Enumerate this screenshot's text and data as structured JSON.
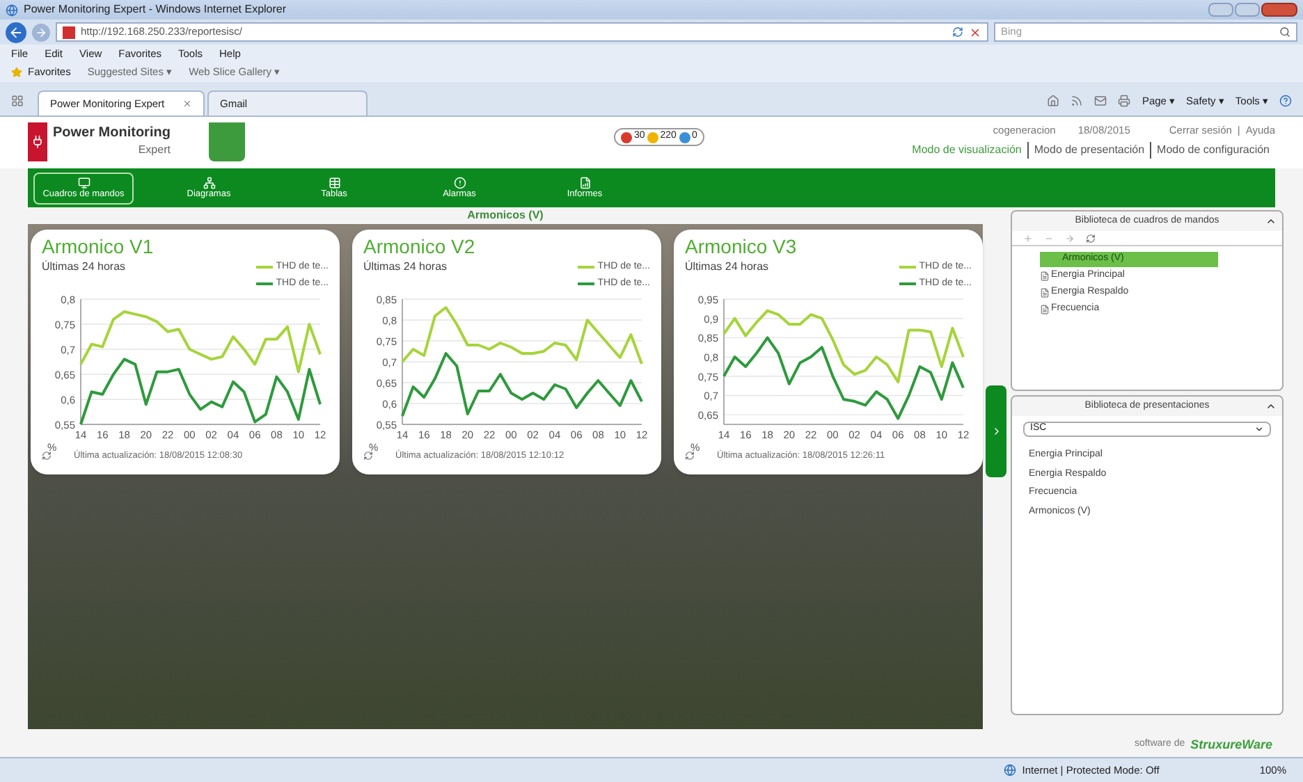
{
  "browser": {
    "title": "Power Monitoring Expert - Windows Internet Explorer",
    "address": "http://192.168.250.233/reportesisc/",
    "search_placeholder": "Bing",
    "menu": [
      "File",
      "Edit",
      "View",
      "Favorites",
      "Tools",
      "Help"
    ],
    "favorites_label": "Favorites",
    "favorites_links": [
      "Suggested Sites ▾",
      "Web Slice Gallery ▾"
    ],
    "tabs": [
      {
        "label": "Power Monitoring Expert",
        "selected": true
      },
      {
        "label": "Gmail",
        "selected": false
      }
    ],
    "commands": [
      "Page ▾",
      "Safety ▾",
      "Tools ▾"
    ],
    "status": "Internet | Protected Mode: Off",
    "zoom": "100%"
  },
  "app": {
    "logo": {
      "line1": "Power Monitoring",
      "line2": "Expert"
    },
    "alarms": [
      {
        "kind": "critical",
        "count": "30"
      },
      {
        "kind": "warning",
        "count": "220"
      },
      {
        "kind": "info",
        "count": "0"
      }
    ],
    "user": "cogeneracion",
    "date": "18/08/2015",
    "links": [
      "Cerrar sesión",
      "Ayuda"
    ],
    "link_separator": "|",
    "modes": [
      {
        "label": "Modo de visualización",
        "selected": true
      },
      {
        "label": "Modo de presentación",
        "selected": false
      },
      {
        "label": "Modo de configuración",
        "selected": false
      }
    ],
    "nav": [
      {
        "kind": "dashboards",
        "label": "Cuadros de mandos",
        "selected": true
      },
      {
        "kind": "diagrams",
        "label": "Diagramas",
        "selected": false
      },
      {
        "kind": "tables",
        "label": "Tablas",
        "selected": false
      },
      {
        "kind": "alarms",
        "label": "Alarmas",
        "selected": false
      },
      {
        "kind": "reports",
        "label": "Informes",
        "selected": false
      }
    ],
    "page_title": "Armonicos (V)",
    "dashboards": [
      {
        "title": "Armonico V1",
        "subtitle": "Últimas 24 horas",
        "updated": "Última actualización: 18/08/2015 12:08:30",
        "chart_data": {
          "type": "line",
          "grid": true,
          "ylabel": "%",
          "categories": [
            "14",
            null,
            "16",
            null,
            "18",
            null,
            "20",
            null,
            "22",
            null,
            "00",
            null,
            "02",
            null,
            "04",
            null,
            "06",
            null,
            "08",
            null,
            "10",
            null,
            "12"
          ],
          "ylim": [
            0.55,
            0.8
          ],
          "yticks": [
            {
              "value": 0.55,
              "label": "0,55"
            },
            {
              "value": 0.6,
              "label": "0,6"
            },
            {
              "value": 0.65,
              "label": "0,65"
            },
            {
              "value": 0.7,
              "label": "0,7"
            },
            {
              "value": 0.75,
              "label": "0,75"
            },
            {
              "value": 0.8,
              "label": "0,8"
            }
          ],
          "series": [
            {
              "name": "THD de te...",
              "color": "#a6d43a",
              "values": [
                0.67,
                0.71,
                0.705,
                0.76,
                0.775,
                0.77,
                0.765,
                0.755,
                0.735,
                0.74,
                0.7,
                0.69,
                0.68,
                0.685,
                0.725,
                0.7,
                0.67,
                0.72,
                0.72,
                0.745,
                0.655,
                0.75,
                0.69
              ]
            },
            {
              "name": "THD de te...",
              "color": "#2e9a3c",
              "values": [
                0.55,
                0.615,
                0.61,
                0.65,
                0.68,
                0.67,
                0.59,
                0.655,
                0.655,
                0.66,
                0.61,
                0.58,
                0.595,
                0.585,
                0.635,
                0.615,
                0.555,
                0.57,
                0.645,
                0.615,
                0.56,
                0.66,
                0.59
              ]
            }
          ]
        }
      },
      {
        "title": "Armonico V2",
        "subtitle": "Últimas 24 horas",
        "updated": "Última actualización: 18/08/2015 12:10:12",
        "chart_data": {
          "type": "line",
          "grid": true,
          "ylabel": "%",
          "categories": [
            "14",
            null,
            "16",
            null,
            "18",
            null,
            "20",
            null,
            "22",
            null,
            "00",
            null,
            "02",
            null,
            "04",
            null,
            "06",
            null,
            "08",
            null,
            "10",
            null,
            "12"
          ],
          "ylim": [
            0.55,
            0.85
          ],
          "yticks": [
            {
              "value": 0.55,
              "label": "0,55"
            },
            {
              "value": 0.6,
              "label": "0,6"
            },
            {
              "value": 0.65,
              "label": "0,65"
            },
            {
              "value": 0.7,
              "label": "0,7"
            },
            {
              "value": 0.75,
              "label": "0,75"
            },
            {
              "value": 0.8,
              "label": "0,8"
            },
            {
              "value": 0.85,
              "label": "0,85"
            }
          ],
          "series": [
            {
              "name": "THD de te...",
              "color": "#a6d43a",
              "values": [
                0.7,
                0.73,
                0.715,
                0.81,
                0.83,
                0.79,
                0.74,
                0.74,
                0.73,
                0.745,
                0.735,
                0.72,
                0.72,
                0.725,
                0.745,
                0.74,
                0.705,
                0.8,
                0.77,
                0.74,
                0.71,
                0.765,
                0.695
              ]
            },
            {
              "name": "THD de te...",
              "color": "#2e9a3c",
              "values": [
                0.57,
                0.64,
                0.615,
                0.66,
                0.72,
                0.69,
                0.575,
                0.63,
                0.63,
                0.67,
                0.625,
                0.61,
                0.625,
                0.61,
                0.645,
                0.635,
                0.59,
                0.625,
                0.655,
                0.625,
                0.595,
                0.655,
                0.605
              ]
            }
          ]
        }
      },
      {
        "title": "Armonico V3",
        "subtitle": "Últimas 24 horas",
        "updated": "Última actualización: 18/08/2015 12:26:11",
        "chart_data": {
          "type": "line",
          "grid": true,
          "ylabel": "%",
          "categories": [
            "14",
            null,
            "16",
            null,
            "18",
            null,
            "20",
            null,
            "22",
            null,
            "00",
            null,
            "02",
            null,
            "04",
            null,
            "06",
            null,
            "08",
            null,
            "10",
            null,
            "12"
          ],
          "ylim": [
            0.625,
            0.95
          ],
          "yticks": [
            {
              "value": 0.65,
              "label": "0,65"
            },
            {
              "value": 0.7,
              "label": "0,7"
            },
            {
              "value": 0.75,
              "label": "0,75"
            },
            {
              "value": 0.8,
              "label": "0,8"
            },
            {
              "value": 0.85,
              "label": "0,85"
            },
            {
              "value": 0.9,
              "label": "0,9"
            },
            {
              "value": 0.95,
              "label": "0,95"
            }
          ],
          "series": [
            {
              "name": "THD de te...",
              "color": "#a6d43a",
              "values": [
                0.86,
                0.9,
                0.855,
                0.89,
                0.92,
                0.91,
                0.885,
                0.885,
                0.91,
                0.9,
                0.845,
                0.78,
                0.755,
                0.765,
                0.8,
                0.78,
                0.735,
                0.87,
                0.87,
                0.865,
                0.775,
                0.875,
                0.8
              ]
            },
            {
              "name": "THD de te...",
              "color": "#2e9a3c",
              "values": [
                0.75,
                0.8,
                0.775,
                0.81,
                0.85,
                0.81,
                0.73,
                0.785,
                0.8,
                0.825,
                0.75,
                0.69,
                0.685,
                0.675,
                0.71,
                0.69,
                0.64,
                0.7,
                0.775,
                0.76,
                0.69,
                0.785,
                0.72
              ]
            }
          ]
        }
      }
    ],
    "dashboard_library": {
      "title": "Biblioteca de cuadros de mandos",
      "items": [
        {
          "label": "Armonicos (V)",
          "selected": true
        },
        {
          "label": "Energia Principal",
          "selected": false
        },
        {
          "label": "Energia Respaldo",
          "selected": false
        },
        {
          "label": "Frecuencia",
          "selected": false
        }
      ]
    },
    "presentation_library": {
      "title": "Biblioteca de presentaciones",
      "select": "ISC",
      "items": [
        "Energia Principal",
        "Energia Respaldo",
        "Frecuencia",
        "Armonicos (V)"
      ]
    },
    "footer": {
      "prefix": "software de",
      "brand": "StruxureWare"
    }
  }
}
